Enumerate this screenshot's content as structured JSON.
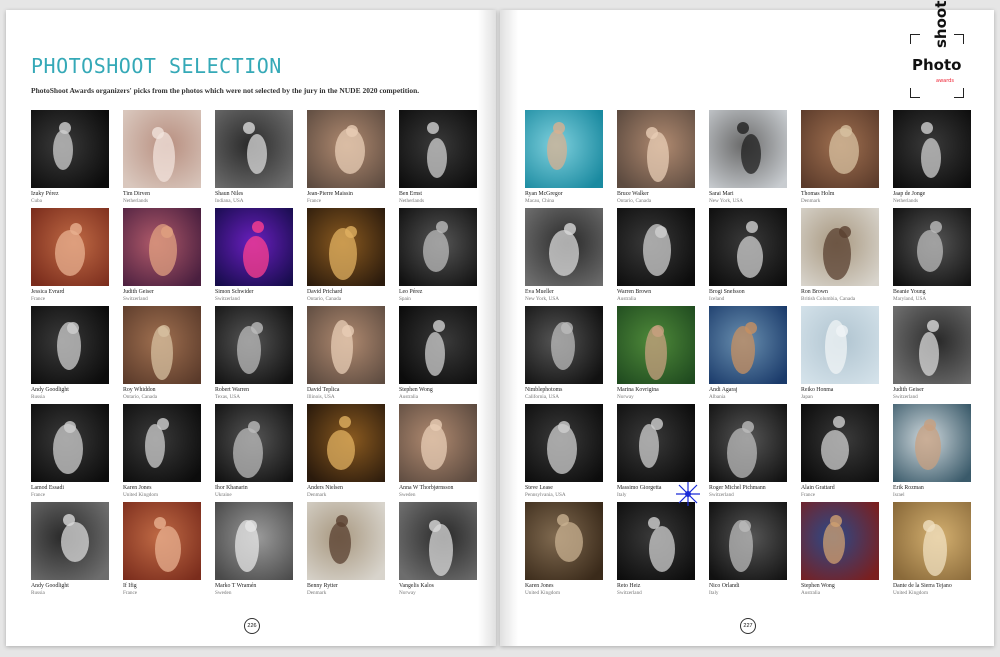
{
  "left_page": {
    "title": "PHOTOSHOOT SELECTION",
    "subtitle": "PhotoShoot Awards organizers' picks from the photos which were not selected by the jury in the NUDE 2020 competition.",
    "page_number": "226",
    "entries": [
      {
        "name": "Izuky Pérez",
        "location": "Cuba",
        "photo": "a"
      },
      {
        "name": "Tim Dirven",
        "location": "Netherlands",
        "photo": "b"
      },
      {
        "name": "Shaun Niles",
        "location": "Indiana, USA",
        "photo": "c"
      },
      {
        "name": "Jean-Pierre Maissin",
        "location": "France",
        "photo": "d"
      },
      {
        "name": "Ben Ernst",
        "location": "Netherlands",
        "photo": "a"
      },
      {
        "name": "Jessica Evrard",
        "location": "France",
        "photo": "e"
      },
      {
        "name": "Judith Geiser",
        "location": "Switzerland",
        "photo": "f"
      },
      {
        "name": "Simon Schwider",
        "location": "Switzerland",
        "photo": "g"
      },
      {
        "name": "David Prichard",
        "location": "Ontario, Canada",
        "photo": "h"
      },
      {
        "name": "Leo Pérez",
        "location": "Spain",
        "photo": "i"
      },
      {
        "name": "Andy Goodlight",
        "location": "Russia",
        "photo": "a"
      },
      {
        "name": "Roy Whiddon",
        "location": "Ontario, Canada",
        "photo": "j"
      },
      {
        "name": "Robert Warren",
        "location": "Texas, USA",
        "photo": "i"
      },
      {
        "name": "David Teplica",
        "location": "Illinois, USA",
        "photo": "d"
      },
      {
        "name": "Stephen Wong",
        "location": "Australia",
        "photo": "a"
      },
      {
        "name": "Lamod Essadi",
        "location": "France",
        "photo": "a"
      },
      {
        "name": "Karen Jones",
        "location": "United Kingdom",
        "photo": "a"
      },
      {
        "name": "Ihor Khanarin",
        "location": "Ukraine",
        "photo": "i"
      },
      {
        "name": "Anders Nielsen",
        "location": "Denmark",
        "photo": "h"
      },
      {
        "name": "Anna W Thorbjørnsson",
        "location": "Sweden",
        "photo": "d"
      },
      {
        "name": "Andy Goodlight",
        "location": "Russia",
        "photo": "c"
      },
      {
        "name": "If Ifig",
        "location": "France",
        "photo": "e"
      },
      {
        "name": "Marko T Wramén",
        "location": "Sweden",
        "photo": "k"
      },
      {
        "name": "Benny Rytter",
        "location": "Denmark",
        "photo": "l"
      },
      {
        "name": "Vangelis Kalos",
        "location": "Norway",
        "photo": "c"
      }
    ]
  },
  "right_page": {
    "logo": {
      "word1": "Photo",
      "word2": "shoot",
      "word3": "awards"
    },
    "page_number": "227",
    "entries": [
      {
        "name": "Ryan McGregor",
        "location": "Macau, China",
        "photo": "m"
      },
      {
        "name": "Bruce Walker",
        "location": "Ontario, Canada",
        "photo": "d"
      },
      {
        "name": "Sarai Mari",
        "location": "New York, USA",
        "photo": "n"
      },
      {
        "name": "Thomas Holm",
        "location": "Denmark",
        "photo": "j"
      },
      {
        "name": "Jaap de Jonge",
        "location": "Netherlands",
        "photo": "a"
      },
      {
        "name": "Eva Mueller",
        "location": "New York, USA",
        "photo": "c"
      },
      {
        "name": "Warren Brown",
        "location": "Australia",
        "photo": "a"
      },
      {
        "name": "Brogi Snefsson",
        "location": "Iceland",
        "photo": "a"
      },
      {
        "name": "Ron Brown",
        "location": "British Columbia, Canada",
        "photo": "l"
      },
      {
        "name": "Beanie Young",
        "location": "Maryland, USA",
        "photo": "i"
      },
      {
        "name": "Nimblephotoms",
        "location": "California, USA",
        "photo": "i"
      },
      {
        "name": "Marina Kovrigina",
        "location": "Norway",
        "photo": "o"
      },
      {
        "name": "Andi Agaraj",
        "location": "Albania",
        "photo": "p"
      },
      {
        "name": "Reiko Honma",
        "location": "Japan",
        "photo": "q"
      },
      {
        "name": "Judith Geiser",
        "location": "Switzerland",
        "photo": "c"
      },
      {
        "name": "Steve Lease",
        "location": "Pennsylvania, USA",
        "photo": "a"
      },
      {
        "name": "Massimo Giorgetta",
        "location": "Italy",
        "photo": "a"
      },
      {
        "name": "Roger Michel Pichmann",
        "location": "Switzerland",
        "photo": "i"
      },
      {
        "name": "Alain Grattard",
        "location": "France",
        "photo": "a"
      },
      {
        "name": "Erik Rozman",
        "location": "Israel",
        "photo": "r"
      },
      {
        "name": "Karen Jones",
        "location": "United Kingdom",
        "photo": "s"
      },
      {
        "name": "Reto Heiz",
        "location": "Switzerland",
        "photo": "a"
      },
      {
        "name": "Nico Orlandi",
        "location": "Italy",
        "photo": "i"
      },
      {
        "name": "Stephen Wong",
        "location": "Australia",
        "photo": "t"
      },
      {
        "name": "Dante de la Sierra Tejano",
        "location": "United Kingdom",
        "photo": "u"
      }
    ]
  },
  "photo_palette": {
    "a": [
      "#0c0c0c",
      "#3a3a3a",
      "#cfcfcf"
    ],
    "b": [
      "#d9c7bd",
      "#b88f80",
      "#f1e3dc"
    ],
    "c": [
      "#6d6d6d",
      "#2a2a2a",
      "#dadada"
    ],
    "d": [
      "#5d4b40",
      "#b08a70",
      "#e8cdb5"
    ],
    "e": [
      "#7a2c1c",
      "#c06a45",
      "#e8b090"
    ],
    "f": [
      "#4a1f3f",
      "#b05a6a",
      "#e0a080"
    ],
    "g": [
      "#150c4a",
      "#6a1fbf",
      "#ff3f8f"
    ],
    "h": [
      "#2a1a0c",
      "#8a5a20",
      "#e0b060"
    ],
    "i": [
      "#111111",
      "#555555",
      "#bbbbbb"
    ],
    "j": [
      "#5a3a2a",
      "#a07050",
      "#d7c0a0"
    ],
    "k": [
      "#4a4a4a",
      "#9a9a9a",
      "#e6e6e6"
    ],
    "l": [
      "#d8d4cc",
      "#a89880",
      "#5a4030"
    ],
    "m": [
      "#1a8aa0",
      "#7fd0dd",
      "#d8b090"
    ],
    "n": [
      "#c8ccd0",
      "#6a6a6a",
      "#202020"
    ],
    "o": [
      "#1f4a1f",
      "#4f8a3a",
      "#c8a080"
    ],
    "p": [
      "#1a3a6a",
      "#6a90b0",
      "#c89060"
    ],
    "q": [
      "#d4e2ea",
      "#b0c4d0",
      "#f0f4f6"
    ],
    "r": [
      "#3a5a6a",
      "#cfd8dc",
      "#c8a080"
    ],
    "s": [
      "#3a2a1a",
      "#806a50",
      "#c8b090"
    ],
    "t": [
      "#7a1f1f",
      "#2a4a8a",
      "#d0a070"
    ],
    "u": [
      "#8a6a3a",
      "#d4b070",
      "#f0e0c0"
    ]
  }
}
